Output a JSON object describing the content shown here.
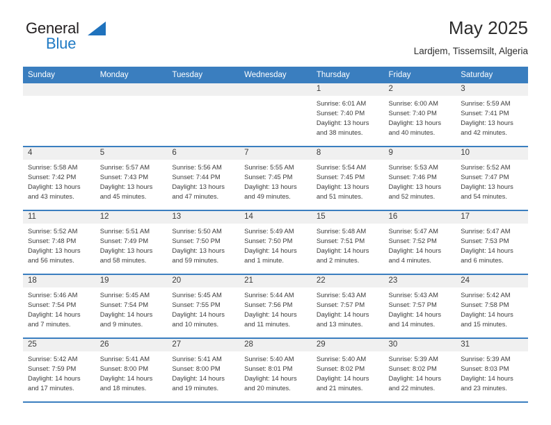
{
  "logo": {
    "word_dark": "General",
    "word_blue": "Blue",
    "triangle": "triangle-icon"
  },
  "header": {
    "title": "May 2025",
    "subtitle": "Lardjem, Tissemsilt, Algeria"
  },
  "colors": {
    "header_blue": "#3a7ebf",
    "logo_blue": "#1f7ac4",
    "row_shade": "#f0f0f0",
    "text": "#3b3b3b"
  },
  "weekdays": [
    "Sunday",
    "Monday",
    "Tuesday",
    "Wednesday",
    "Thursday",
    "Friday",
    "Saturday"
  ],
  "labels": {
    "sunrise_prefix": "Sunrise:",
    "sunset_prefix": "Sunset:",
    "daylight_prefix": "Daylight:"
  },
  "weeks": [
    [
      {
        "day": "",
        "lines": []
      },
      {
        "day": "",
        "lines": []
      },
      {
        "day": "",
        "lines": []
      },
      {
        "day": "",
        "lines": []
      },
      {
        "day": "1",
        "lines": [
          "Sunrise: 6:01 AM",
          "Sunset: 7:40 PM",
          "Daylight: 13 hours",
          "and 38 minutes."
        ]
      },
      {
        "day": "2",
        "lines": [
          "Sunrise: 6:00 AM",
          "Sunset: 7:40 PM",
          "Daylight: 13 hours",
          "and 40 minutes."
        ]
      },
      {
        "day": "3",
        "lines": [
          "Sunrise: 5:59 AM",
          "Sunset: 7:41 PM",
          "Daylight: 13 hours",
          "and 42 minutes."
        ]
      }
    ],
    [
      {
        "day": "4",
        "lines": [
          "Sunrise: 5:58 AM",
          "Sunset: 7:42 PM",
          "Daylight: 13 hours",
          "and 43 minutes."
        ]
      },
      {
        "day": "5",
        "lines": [
          "Sunrise: 5:57 AM",
          "Sunset: 7:43 PM",
          "Daylight: 13 hours",
          "and 45 minutes."
        ]
      },
      {
        "day": "6",
        "lines": [
          "Sunrise: 5:56 AM",
          "Sunset: 7:44 PM",
          "Daylight: 13 hours",
          "and 47 minutes."
        ]
      },
      {
        "day": "7",
        "lines": [
          "Sunrise: 5:55 AM",
          "Sunset: 7:45 PM",
          "Daylight: 13 hours",
          "and 49 minutes."
        ]
      },
      {
        "day": "8",
        "lines": [
          "Sunrise: 5:54 AM",
          "Sunset: 7:45 PM",
          "Daylight: 13 hours",
          "and 51 minutes."
        ]
      },
      {
        "day": "9",
        "lines": [
          "Sunrise: 5:53 AM",
          "Sunset: 7:46 PM",
          "Daylight: 13 hours",
          "and 52 minutes."
        ]
      },
      {
        "day": "10",
        "lines": [
          "Sunrise: 5:52 AM",
          "Sunset: 7:47 PM",
          "Daylight: 13 hours",
          "and 54 minutes."
        ]
      }
    ],
    [
      {
        "day": "11",
        "lines": [
          "Sunrise: 5:52 AM",
          "Sunset: 7:48 PM",
          "Daylight: 13 hours",
          "and 56 minutes."
        ]
      },
      {
        "day": "12",
        "lines": [
          "Sunrise: 5:51 AM",
          "Sunset: 7:49 PM",
          "Daylight: 13 hours",
          "and 58 minutes."
        ]
      },
      {
        "day": "13",
        "lines": [
          "Sunrise: 5:50 AM",
          "Sunset: 7:50 PM",
          "Daylight: 13 hours",
          "and 59 minutes."
        ]
      },
      {
        "day": "14",
        "lines": [
          "Sunrise: 5:49 AM",
          "Sunset: 7:50 PM",
          "Daylight: 14 hours",
          "and 1 minute."
        ]
      },
      {
        "day": "15",
        "lines": [
          "Sunrise: 5:48 AM",
          "Sunset: 7:51 PM",
          "Daylight: 14 hours",
          "and 2 minutes."
        ]
      },
      {
        "day": "16",
        "lines": [
          "Sunrise: 5:47 AM",
          "Sunset: 7:52 PM",
          "Daylight: 14 hours",
          "and 4 minutes."
        ]
      },
      {
        "day": "17",
        "lines": [
          "Sunrise: 5:47 AM",
          "Sunset: 7:53 PM",
          "Daylight: 14 hours",
          "and 6 minutes."
        ]
      }
    ],
    [
      {
        "day": "18",
        "lines": [
          "Sunrise: 5:46 AM",
          "Sunset: 7:54 PM",
          "Daylight: 14 hours",
          "and 7 minutes."
        ]
      },
      {
        "day": "19",
        "lines": [
          "Sunrise: 5:45 AM",
          "Sunset: 7:54 PM",
          "Daylight: 14 hours",
          "and 9 minutes."
        ]
      },
      {
        "day": "20",
        "lines": [
          "Sunrise: 5:45 AM",
          "Sunset: 7:55 PM",
          "Daylight: 14 hours",
          "and 10 minutes."
        ]
      },
      {
        "day": "21",
        "lines": [
          "Sunrise: 5:44 AM",
          "Sunset: 7:56 PM",
          "Daylight: 14 hours",
          "and 11 minutes."
        ]
      },
      {
        "day": "22",
        "lines": [
          "Sunrise: 5:43 AM",
          "Sunset: 7:57 PM",
          "Daylight: 14 hours",
          "and 13 minutes."
        ]
      },
      {
        "day": "23",
        "lines": [
          "Sunrise: 5:43 AM",
          "Sunset: 7:57 PM",
          "Daylight: 14 hours",
          "and 14 minutes."
        ]
      },
      {
        "day": "24",
        "lines": [
          "Sunrise: 5:42 AM",
          "Sunset: 7:58 PM",
          "Daylight: 14 hours",
          "and 15 minutes."
        ]
      }
    ],
    [
      {
        "day": "25",
        "lines": [
          "Sunrise: 5:42 AM",
          "Sunset: 7:59 PM",
          "Daylight: 14 hours",
          "and 17 minutes."
        ]
      },
      {
        "day": "26",
        "lines": [
          "Sunrise: 5:41 AM",
          "Sunset: 8:00 PM",
          "Daylight: 14 hours",
          "and 18 minutes."
        ]
      },
      {
        "day": "27",
        "lines": [
          "Sunrise: 5:41 AM",
          "Sunset: 8:00 PM",
          "Daylight: 14 hours",
          "and 19 minutes."
        ]
      },
      {
        "day": "28",
        "lines": [
          "Sunrise: 5:40 AM",
          "Sunset: 8:01 PM",
          "Daylight: 14 hours",
          "and 20 minutes."
        ]
      },
      {
        "day": "29",
        "lines": [
          "Sunrise: 5:40 AM",
          "Sunset: 8:02 PM",
          "Daylight: 14 hours",
          "and 21 minutes."
        ]
      },
      {
        "day": "30",
        "lines": [
          "Sunrise: 5:39 AM",
          "Sunset: 8:02 PM",
          "Daylight: 14 hours",
          "and 22 minutes."
        ]
      },
      {
        "day": "31",
        "lines": [
          "Sunrise: 5:39 AM",
          "Sunset: 8:03 PM",
          "Daylight: 14 hours",
          "and 23 minutes."
        ]
      }
    ]
  ]
}
